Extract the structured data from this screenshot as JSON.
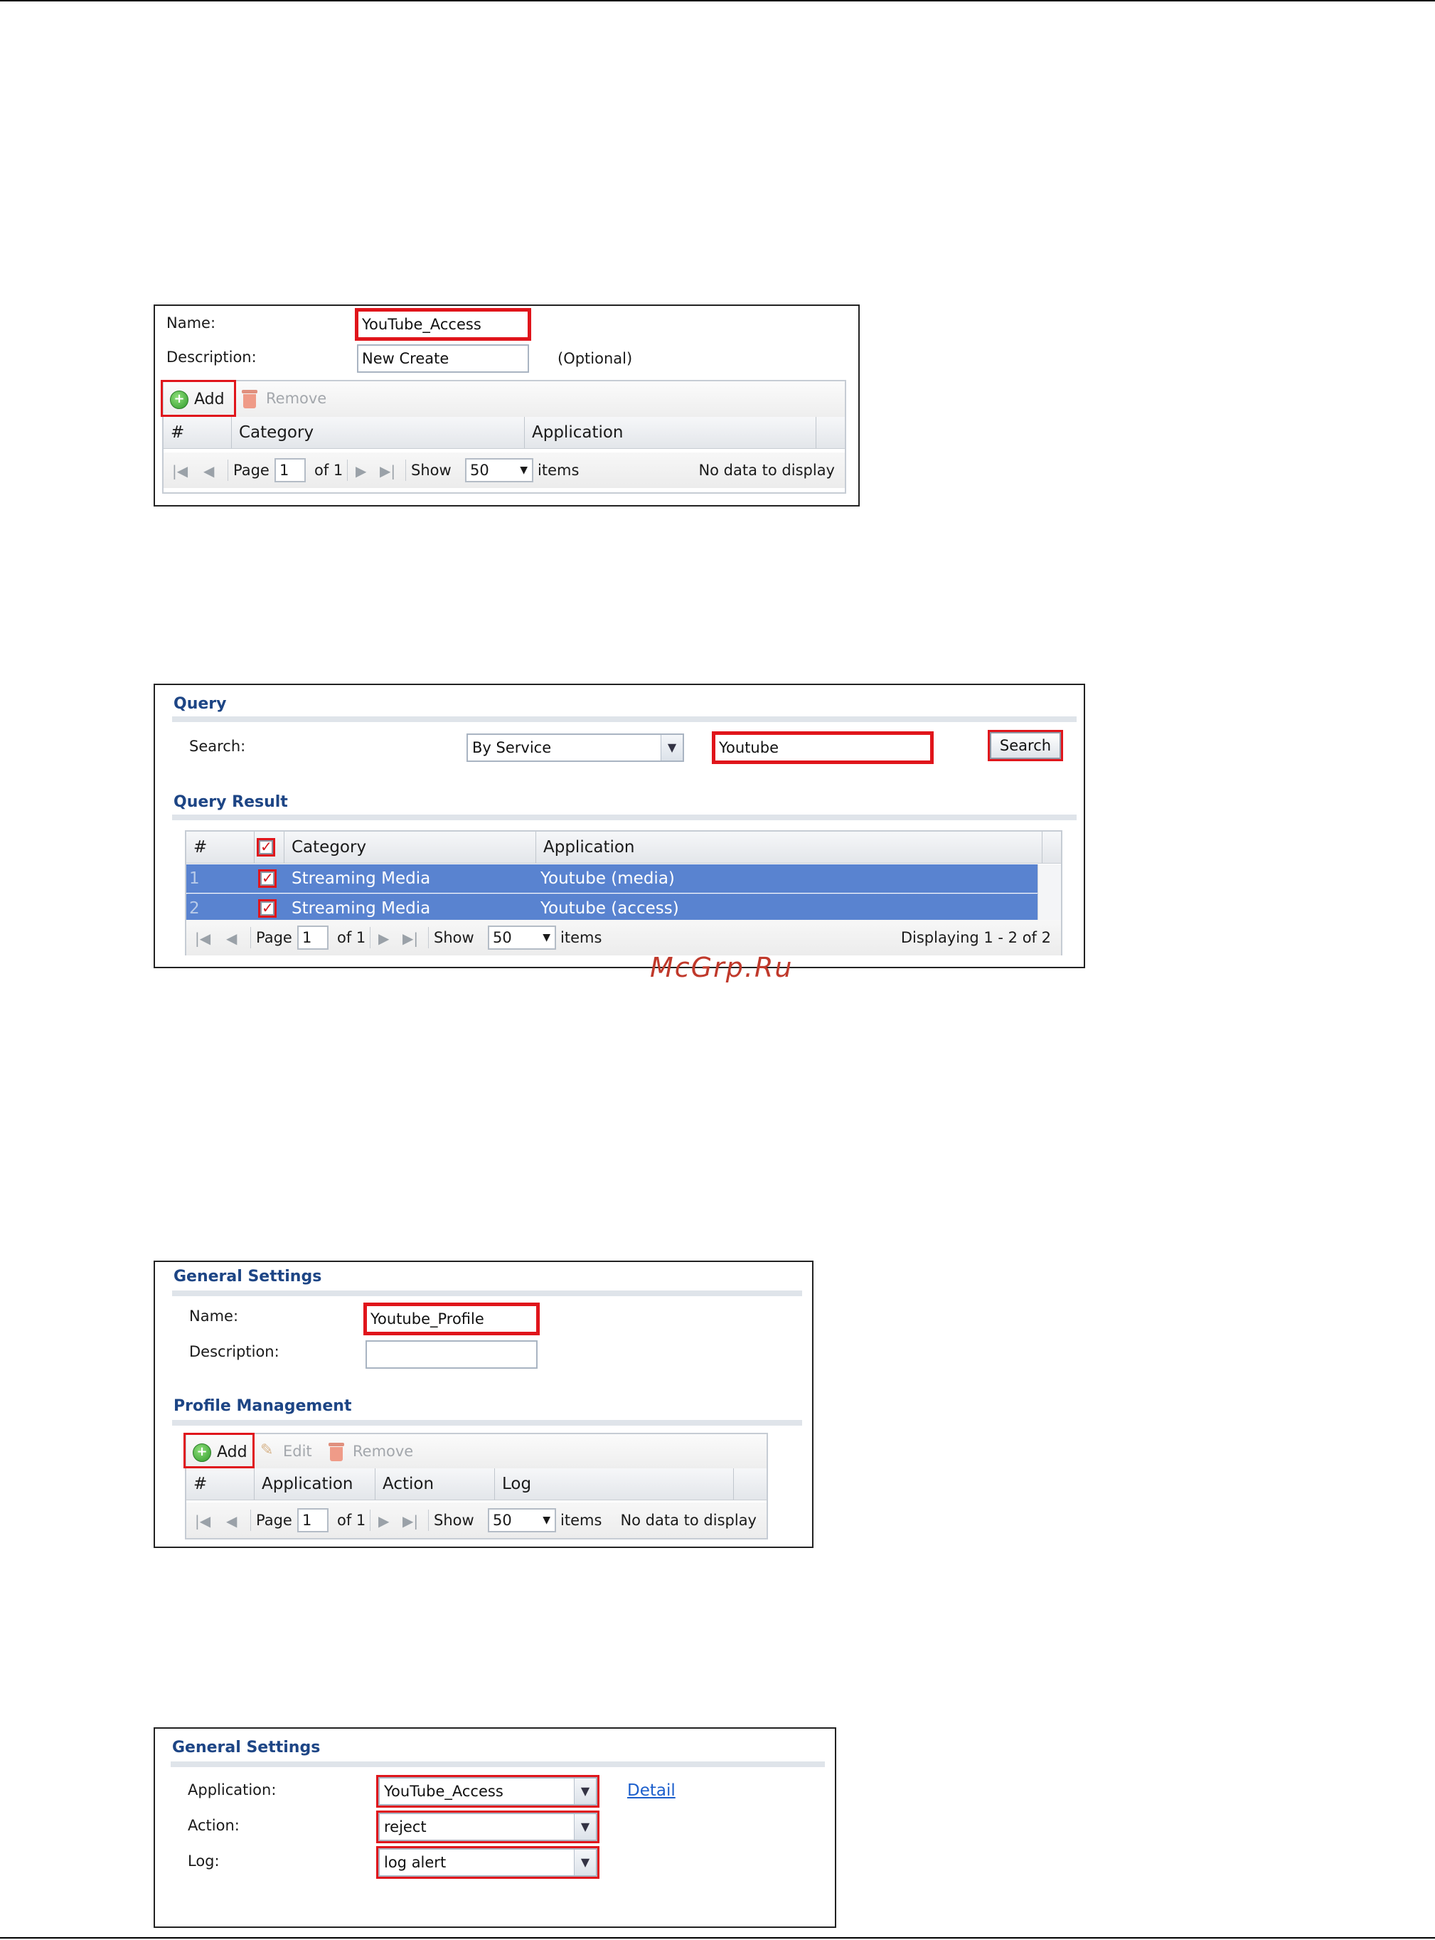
{
  "watermark": "McGrp.Ru",
  "panel1": {
    "name_label": "Name:",
    "name_value": "YouTube_Access",
    "description_label": "Description:",
    "description_value": "New Create",
    "optional_text": "(Optional)",
    "toolbar": {
      "add_label": "Add",
      "remove_label": "Remove"
    },
    "columns": [
      "#",
      "Category",
      "Application"
    ],
    "pager": {
      "page_label": "Page",
      "page_value": "1",
      "of_label": "of 1",
      "show_label": "Show",
      "show_value": "50",
      "items_label": "items",
      "status": "No data to display"
    }
  },
  "panel2": {
    "query_title": "Query",
    "search_label": "Search:",
    "search_by": "By Service",
    "search_value": "Youtube",
    "search_button": "Search",
    "result_title": "Query Result",
    "columns": [
      "#",
      "Category",
      "Application"
    ],
    "rows": [
      {
        "num": "1",
        "category": "Streaming Media",
        "application": "Youtube (media)"
      },
      {
        "num": "2",
        "category": "Streaming Media",
        "application": "Youtube (access)"
      }
    ],
    "pager": {
      "page_label": "Page",
      "page_value": "1",
      "of_label": "of 1",
      "show_label": "Show",
      "show_value": "50",
      "items_label": "items",
      "status": "Displaying 1 - 2 of 2"
    }
  },
  "panel3": {
    "general_title": "General Settings",
    "name_label": "Name:",
    "name_value": "Youtube_Profile",
    "description_label": "Description:",
    "description_value": "",
    "profile_title": "Profile Management",
    "toolbar": {
      "add_label": "Add",
      "edit_label": "Edit",
      "remove_label": "Remove"
    },
    "columns": [
      "#",
      "Application",
      "Action",
      "Log"
    ],
    "pager": {
      "page_label": "Page",
      "page_value": "1",
      "of_label": "of 1",
      "show_label": "Show",
      "show_value": "50",
      "items_label": "items",
      "status": "No data to display"
    }
  },
  "panel4": {
    "general_title": "General Settings",
    "application_label": "Application:",
    "application_value": "YouTube_Access",
    "detail_link": "Detail",
    "action_label": "Action:",
    "action_value": "reject",
    "log_label": "Log:",
    "log_value": "log alert"
  },
  "colors": {
    "highlight": "#e0151b",
    "selected_row": "#5983d0",
    "section_title": "#1d4585"
  }
}
